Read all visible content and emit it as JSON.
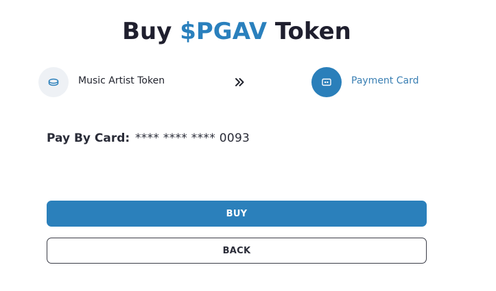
{
  "header": {
    "title_prefix": "Buy ",
    "title_accent": "$PGAV",
    "title_suffix": " Token"
  },
  "steps": {
    "from": {
      "label": "Music Artist Token",
      "icon": "coin-icon"
    },
    "arrow": {
      "icon": "double-chevron-right-icon"
    },
    "to": {
      "label": "Payment Card",
      "icon": "card-icon"
    }
  },
  "payment": {
    "label": "Pay By Card:",
    "card_number": "**** **** **** 0093"
  },
  "actions": {
    "buy_label": "BUY",
    "back_label": "BACK"
  },
  "colors": {
    "accent": "#2a80bd",
    "button_primary": "#2b80bb",
    "text_dark": "#1f1f2e"
  }
}
